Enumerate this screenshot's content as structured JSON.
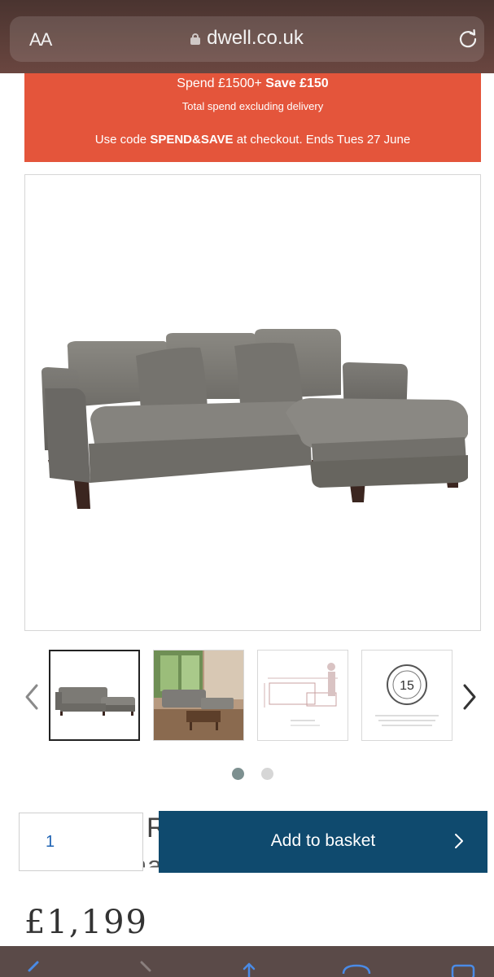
{
  "browser": {
    "text_size_label": "AA",
    "domain": "dwell.co.uk"
  },
  "promo": {
    "line1_prefix": "Spend £1500+",
    "line1_bold": "Save £150",
    "line2": "Total spend excluding delivery",
    "line3_prefix": "Use code",
    "line3_code": "SPEND&SAVE",
    "line3_suffix": "at checkout. Ends Tues 27 June"
  },
  "gallery": {
    "thumbnails": [
      {
        "name": "sofa-front",
        "active": true
      },
      {
        "name": "sofa-lifestyle",
        "active": false
      },
      {
        "name": "sofa-dimensions",
        "active": false
      },
      {
        "name": "15-year-guarantee",
        "active": false
      }
    ],
    "guarantee_number": "15",
    "page_dots": [
      {
        "active": true
      },
      {
        "active": false
      }
    ],
    "colors": {
      "dot_active": "#7d9090",
      "dot_inactive": "#d6d6d6"
    }
  },
  "purchase": {
    "quantity": "1",
    "add_to_basket_label": "Add to basket",
    "product_title_peek_letter": "R",
    "product_title_peek_line2": "Seater Chaise End Sofa",
    "price": "£1,199",
    "colors": {
      "basket_bg": "#0f4a6e",
      "promo_bg": "#e4553b"
    }
  }
}
